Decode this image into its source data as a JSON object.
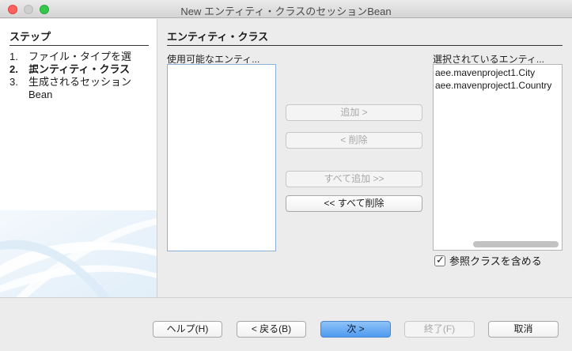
{
  "window": {
    "title": "New エンティティ・クラスのセッションBean"
  },
  "steps": {
    "heading": "ステップ",
    "items": [
      {
        "num": "1.",
        "label": "ファイル・タイプを選択"
      },
      {
        "num": "2.",
        "label": "エンティティ・クラス"
      },
      {
        "num": "3.",
        "label": "生成されるセッションBean"
      }
    ],
    "active_index": 2
  },
  "content": {
    "heading": "エンティティ・クラス",
    "available_label": "使用可能なエンティ...",
    "selected_label": "選択されているエンティ...",
    "available_items": [],
    "selected_items": [
      "aee.mavenproject1.City",
      "aee.mavenproject1.Country"
    ],
    "buttons": {
      "add": "追加 >",
      "remove": "< 削除",
      "add_all": "すべて追加 >>",
      "remove_all": "<< すべて削除"
    },
    "include_referenced": {
      "label": "参照クラスを含める",
      "checked": true
    }
  },
  "footer": {
    "help": "ヘルプ(H)",
    "back": "< 戻る(B)",
    "next": "次 >",
    "finish": "終了(F)",
    "cancel": "取消"
  }
}
